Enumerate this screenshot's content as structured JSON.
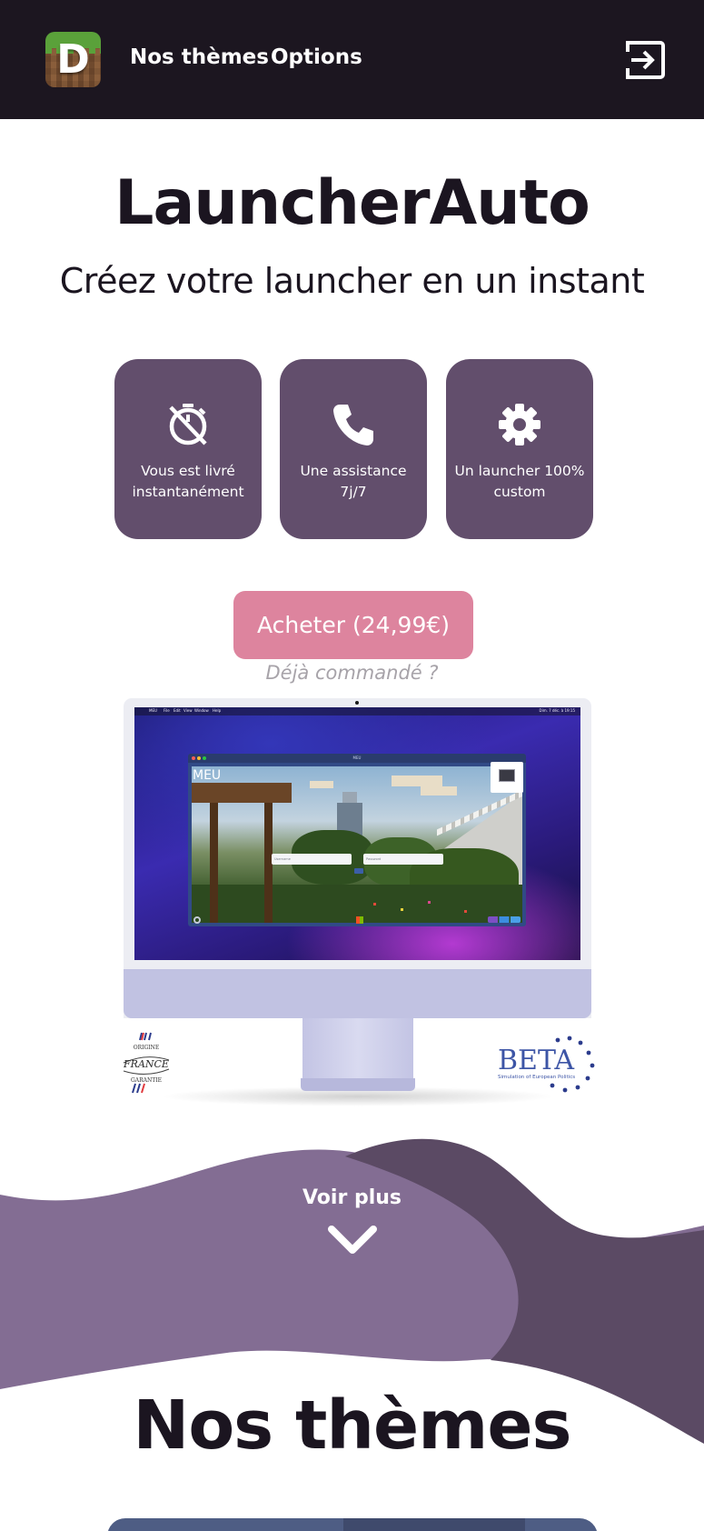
{
  "nav": {
    "logo_letter": "D",
    "links": [
      {
        "label": "Nos thèmes"
      },
      {
        "label": "Options"
      }
    ],
    "logout_icon": "logout-icon"
  },
  "hero": {
    "title": "LauncherAuto",
    "subtitle": "Créez votre launcher en un instant"
  },
  "features": [
    {
      "icon": "timer-off-icon",
      "text": "Vous est livré instantanément"
    },
    {
      "icon": "phone-icon",
      "text": "Une assistance 7j/7"
    },
    {
      "icon": "gear-icon",
      "text": "Un launcher 100% custom"
    }
  ],
  "buy": {
    "button_label": "Acheter (24,99€)",
    "already_ordered": "Déjà commandé ?"
  },
  "preview": {
    "menubar": {
      "app": "MEU",
      "menus": [
        "File",
        "Edit",
        "View",
        "Window",
        "Help"
      ],
      "clock": "Dim. 7 déc. à 19:15"
    },
    "app_window_title": "MEU",
    "launcher_label": "MEU",
    "login_placeholders": [
      "Username",
      "Password"
    ]
  },
  "badges": {
    "france": {
      "top": "ORIGINE",
      "main": "FRANCE",
      "bottom": "GARANTIE"
    },
    "beta": {
      "main": "BETA",
      "caption": "Simulation of European Politics"
    }
  },
  "cta": {
    "voir_plus": "Voir plus",
    "chevron_icon": "chevron-down-icon"
  },
  "themes": {
    "title": "Nos thèmes"
  },
  "colors": {
    "nav_bg": "#1c1620",
    "feature_card": "#624e6c",
    "buy_button": "#dd849e",
    "wave_light": "#836d93",
    "wave_dark": "#5b4a64"
  }
}
